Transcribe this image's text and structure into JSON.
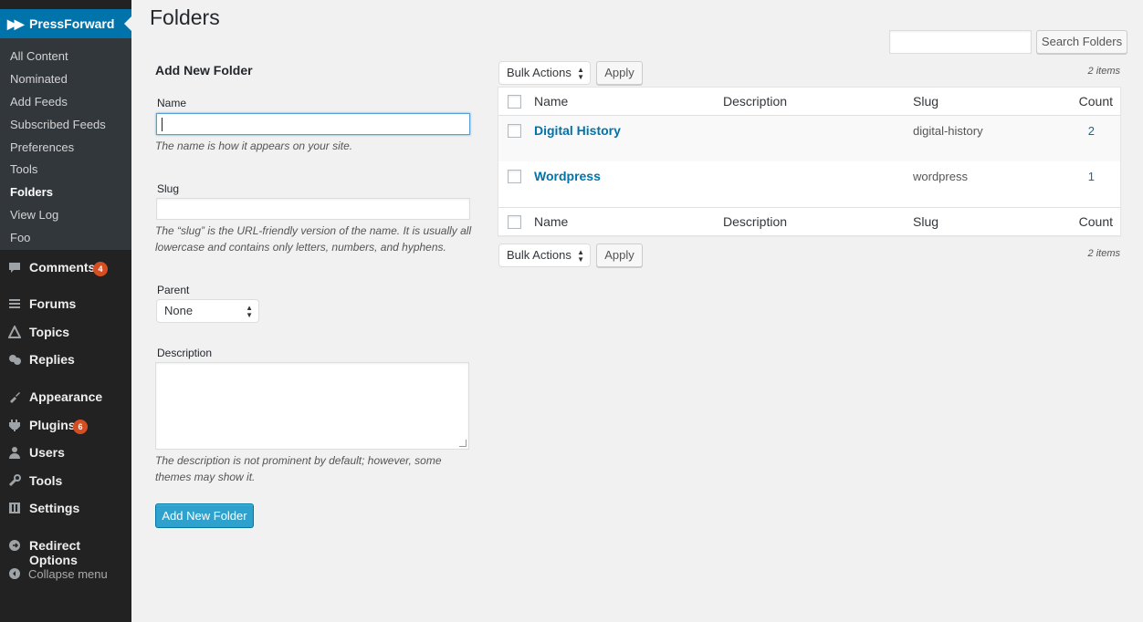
{
  "sidebar": {
    "active_plugin": "PressForward",
    "submenu": [
      "All Content",
      "Nominated",
      "Add Feeds",
      "Subscribed Feeds",
      "Preferences",
      "Tools",
      "Folders",
      "View Log",
      "Foo"
    ],
    "current_submenu": "Folders",
    "menu": [
      {
        "label": "Comments",
        "icon": "comment-icon",
        "badge": "4"
      },
      {
        "label": "Forums",
        "icon": "forums-icon"
      },
      {
        "label": "Topics",
        "icon": "topics-icon"
      },
      {
        "label": "Replies",
        "icon": "replies-icon"
      },
      {
        "label": "Appearance",
        "icon": "appearance-icon"
      },
      {
        "label": "Plugins",
        "icon": "plugins-icon",
        "badge": "6"
      },
      {
        "label": "Users",
        "icon": "users-icon"
      },
      {
        "label": "Tools",
        "icon": "tools-icon"
      },
      {
        "label": "Settings",
        "icon": "settings-icon"
      },
      {
        "label": "Redirect Options",
        "icon": "redirect-icon"
      }
    ],
    "collapse_label": "Collapse menu"
  },
  "page": {
    "title": "Folders",
    "search_button": "Search Folders",
    "search_value": ""
  },
  "form": {
    "heading": "Add New Folder",
    "name_label": "Name",
    "name_value": "",
    "name_help": "The name is how it appears on your site.",
    "slug_label": "Slug",
    "slug_value": "",
    "slug_help": "The “slug” is the URL-friendly version of the name. It is usually all lowercase and contains only letters, numbers, and hyphens.",
    "parent_label": "Parent",
    "parent_value": "None",
    "description_label": "Description",
    "description_value": "",
    "description_help": "The description is not prominent by default; however, some themes may show it.",
    "submit_label": "Add New Folder"
  },
  "table": {
    "bulk_actions_label": "Bulk Actions",
    "apply_label": "Apply",
    "items_count": "2 items",
    "columns": {
      "name": "Name",
      "description": "Description",
      "slug": "Slug",
      "count": "Count"
    },
    "rows": [
      {
        "name": "Digital History",
        "description": "",
        "slug": "digital-history",
        "count": "2"
      },
      {
        "name": "Wordpress",
        "description": "",
        "slug": "wordpress",
        "count": "1"
      }
    ]
  },
  "colors": {
    "sidebar_bg": "#222222",
    "active_menu_bg": "#0073aa",
    "link": "#0073aa",
    "badge": "#d54e21",
    "primary_button": "#2ea2cc"
  }
}
